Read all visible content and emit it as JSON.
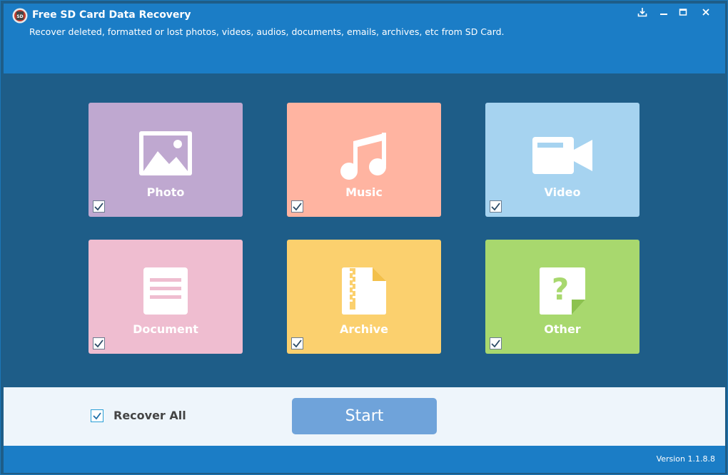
{
  "app": {
    "title": "Free SD Card Data Recovery",
    "subtitle": "Recover deleted, formatted or lost photos, videos, audios, documents, emails, archives, etc from SD Card."
  },
  "window_controls": [
    "download-icon",
    "minimize-icon",
    "maximize-icon",
    "close-icon"
  ],
  "categories": [
    {
      "label": "Photo",
      "checked": true,
      "color": "#bfa8d0",
      "icon": "photo-icon"
    },
    {
      "label": "Music",
      "checked": true,
      "color": "#ffb4a1",
      "icon": "music-icon"
    },
    {
      "label": "Video",
      "checked": true,
      "color": "#a6d3f0",
      "icon": "video-icon"
    },
    {
      "label": "Document",
      "checked": true,
      "color": "#efbdd0",
      "icon": "document-icon"
    },
    {
      "label": "Archive",
      "checked": true,
      "color": "#fbd06e",
      "icon": "archive-icon"
    },
    {
      "label": "Other",
      "checked": true,
      "color": "#a8d86e",
      "icon": "other-icon"
    }
  ],
  "bottom": {
    "recover_all_label": "Recover All",
    "recover_all_checked": true,
    "start_label": "Start"
  },
  "footer": {
    "version": "Version 1.1.8.8"
  }
}
